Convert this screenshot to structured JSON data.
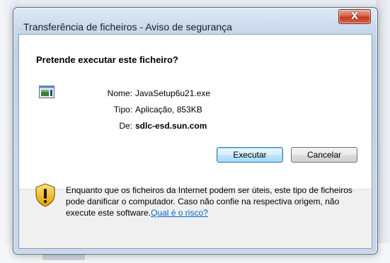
{
  "window": {
    "title": "Transferência de ficheiros - Aviso de segurança",
    "close_glyph": "X"
  },
  "dialog": {
    "question": "Pretende executar este ficheiro?",
    "file_icon": "application-icon",
    "fields": [
      {
        "label": "Nome:",
        "value": "JavaSetup6u21.exe"
      },
      {
        "label": "Tipo:",
        "value": "Aplicação, 853KB"
      },
      {
        "label": "De:",
        "value": "sdlc-esd.sun.com"
      }
    ],
    "run_button": "Executar",
    "cancel_button": "Cancelar"
  },
  "warning": {
    "icon": "shield-warning-icon",
    "text": "Enquanto que os ficheiros da Internet podem ser úteis, este tipo de ficheiros pode danificar o computador. Caso não confie na respectiva origem, não execute este software.",
    "link": "Qual é o risco?"
  }
}
